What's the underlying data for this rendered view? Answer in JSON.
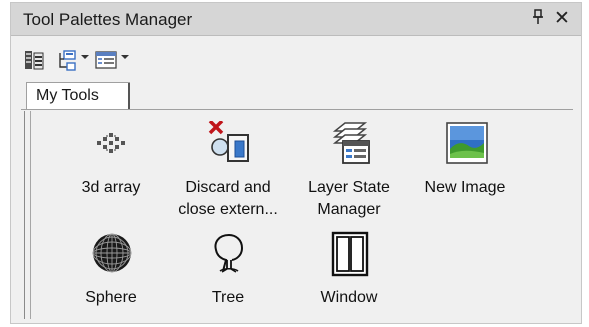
{
  "window": {
    "title": "Tool Palettes Manager",
    "pin_glyph": "†",
    "close_glyph": "✕"
  },
  "toolbar": {
    "buttons": [
      {
        "icon": "palette-properties-icon",
        "has_dropdown": false
      },
      {
        "icon": "tool-palette-tree-icon",
        "has_dropdown": true
      },
      {
        "icon": "palette-view-options-icon",
        "has_dropdown": true
      }
    ]
  },
  "tabs": [
    {
      "label": "My Tools",
      "active": true
    }
  ],
  "tools": [
    {
      "label": "3d array",
      "icon": "3d-array-icon"
    },
    {
      "label": "Discard and\nclose extern...",
      "icon": "discard-close-external-icon"
    },
    {
      "label": "Layer State\nManager",
      "icon": "layer-state-manager-icon"
    },
    {
      "label": "New Image",
      "icon": "image-icon"
    },
    {
      "label": "Sphere",
      "icon": "sphere-icon"
    },
    {
      "label": "Tree",
      "icon": "tree-icon"
    },
    {
      "label": "Window",
      "icon": "window-icon"
    }
  ],
  "colors": {
    "accent_red": "#c0151a",
    "image_blue": "#2f6fc4",
    "image_green": "#3f9a2d"
  }
}
